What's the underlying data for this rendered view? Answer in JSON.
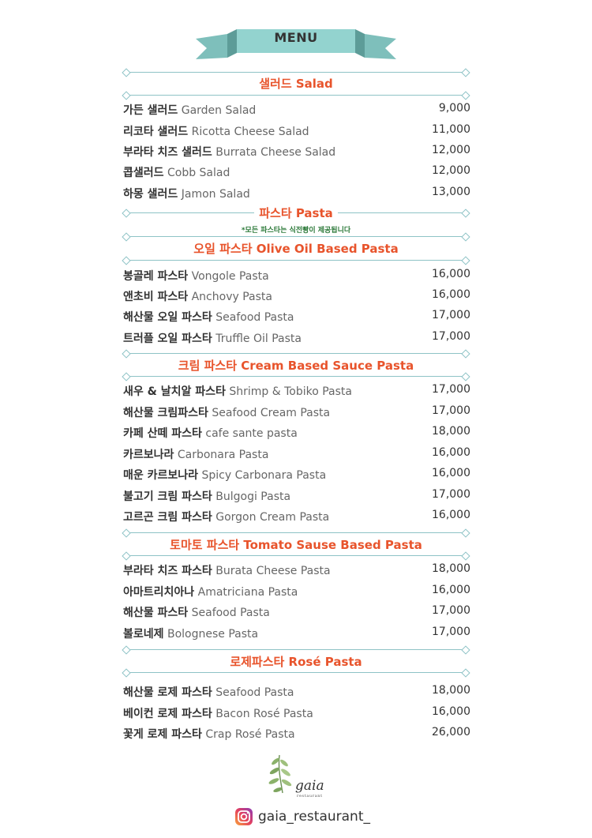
{
  "header": {
    "title": "MENU"
  },
  "sections": {
    "salad": {
      "title": "샐러드 Salad",
      "items": [
        {
          "ko": "가든 샐러드",
          "en": "Garden Salad",
          "price": "9,000"
        },
        {
          "ko": "리코타 샐러드",
          "en": "Ricotta Cheese Salad",
          "price": "11,000"
        },
        {
          "ko": "부라타 치즈 샐러드",
          "en": "Burrata Cheese Salad",
          "price": "12,000"
        },
        {
          "ko": "콥샐러드",
          "en": "Cobb Salad",
          "price": "12,000"
        },
        {
          "ko": "하몽 샐러드",
          "en": "Jamon Salad",
          "price": "13,000"
        }
      ]
    },
    "pasta": {
      "title": "파스타 Pasta",
      "note": "*모든 파스타는 식전빵이 제공됩니다"
    },
    "oil": {
      "title": "오일 파스타 Olive Oil Based Pasta",
      "items": [
        {
          "ko": "봉골레 파스타",
          "en": "Vongole Pasta",
          "price": "16,000"
        },
        {
          "ko": "앤초비 파스타",
          "en": "Anchovy Pasta",
          "price": "16,000"
        },
        {
          "ko": "해산물 오일 파스타",
          "en": "Seafood Pasta",
          "price": "17,000"
        },
        {
          "ko": "트러플 오일 파스타",
          "en": "Truffle Oil Pasta",
          "price": "17,000"
        }
      ]
    },
    "cream": {
      "title": "크림 파스타 Cream Based Sauce Pasta",
      "items": [
        {
          "ko": "새우 & 날치알 파스타",
          "en": "Shrimp & Tobiko Pasta",
          "price": "17,000"
        },
        {
          "ko": "해산물 크림파스타",
          "en": "Seafood Cream Pasta",
          "price": "17,000"
        },
        {
          "ko": "카페 산떼 파스타",
          "en": "cafe sante pasta",
          "price": "18,000"
        },
        {
          "ko": "카르보나라",
          "en": "Carbonara Pasta",
          "price": "16,000"
        },
        {
          "ko": "매운 카르보나라",
          "en": "Spicy Carbonara Pasta",
          "price": "16,000"
        },
        {
          "ko": "불고기 크림 파스타",
          "en": "Bulgogi Pasta",
          "price": "17,000"
        },
        {
          "ko": "고르곤 크림 파스타",
          "en": "Gorgon Cream Pasta",
          "price": "16,000"
        }
      ]
    },
    "tomato": {
      "title": "토마토 파스타 Tomato Sause Based Pasta",
      "items": [
        {
          "ko": "부라타 치즈 파스타",
          "en": "Burata Cheese Pasta",
          "price": "18,000"
        },
        {
          "ko": "아마트리치아나",
          "en": "Amatriciana Pasta",
          "price": "16,000"
        },
        {
          "ko": "해산물 파스타",
          "en": "Seafood Pasta",
          "price": "17,000"
        },
        {
          "ko": "볼로네제",
          "en": "Bolognese Pasta",
          "price": "17,000"
        }
      ]
    },
    "rose": {
      "title": "로제파스타 Rosé Pasta",
      "items": [
        {
          "ko": "해산물 로제 파스타",
          "en": "Seafood Pasta",
          "price": "18,000"
        },
        {
          "ko": "베이컨 로제 파스타",
          "en": "Bacon Rosé Pasta",
          "price": "16,000"
        },
        {
          "ko": "꽃게 로제 파스타",
          "en": "Crap Rosé Pasta",
          "price": "26,000"
        }
      ]
    }
  },
  "logo": {
    "name": "gaia",
    "subtitle": "restaurant"
  },
  "instagram": {
    "handle": "gaia_restaurant_"
  },
  "colors": {
    "accent": "#e8542c",
    "banner": "#8fcfcb",
    "rule": "#8ec3c6",
    "note": "#2d7a3a"
  }
}
